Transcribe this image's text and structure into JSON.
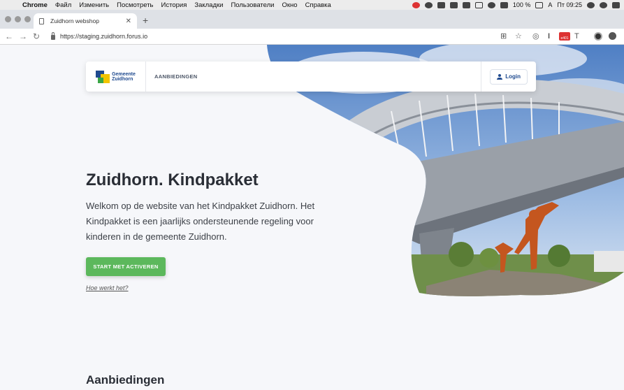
{
  "menubar": {
    "app": "Chrome",
    "items": [
      "Файл",
      "Изменить",
      "Посмотреть",
      "История",
      "Закладки",
      "Пользователи",
      "Окно",
      "Справка"
    ],
    "battery": "100 %",
    "input_source": "A",
    "clock": "Пт 09:25"
  },
  "browser": {
    "tab_title": "Zuidhorn webshop",
    "url": "https://staging.zuidhorn.forus.io",
    "extension_badge": "e401"
  },
  "site": {
    "logo_line1": "Gemeente",
    "logo_line2": "Zuidhorn",
    "nav_offers": "AANBIEDINGEN",
    "login": "Login",
    "hero_title": "Zuidhorn. Kindpakket",
    "hero_text": "Welkom op de website van het Kindpakket Zuidhorn. Het Kindpakket is een jaarlijks ondersteunende regeling voor kinderen in de gemeente Zuidhorn.",
    "cta": "START MET ACTIVEREN",
    "how_link": "Hoe werkt het?",
    "section_title": "Aanbiedingen"
  },
  "colors": {
    "brand_blue": "#1f4a8f",
    "cta_green": "#5cb85c",
    "page_bg": "#f6f7fa"
  }
}
